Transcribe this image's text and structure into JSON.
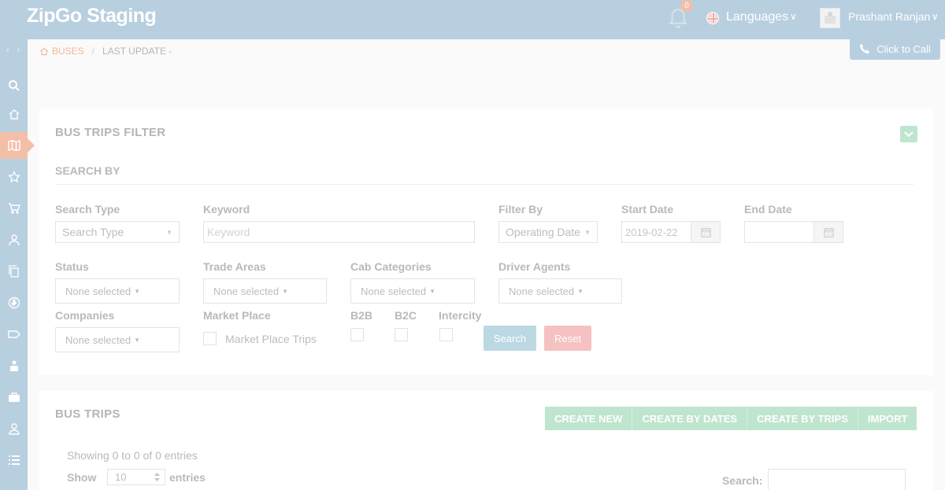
{
  "header": {
    "brand": "ZipGo Staging",
    "notification_count": "0",
    "languages_label": "Languages",
    "user_name": "Prashant Ranjan",
    "caret": "∨"
  },
  "sidebar": {
    "toggle": "‹ ›",
    "items": [
      {
        "icon": "search-icon"
      },
      {
        "icon": "home-icon"
      },
      {
        "icon": "map-icon",
        "active": true
      },
      {
        "icon": "star-icon"
      },
      {
        "icon": "cart-icon"
      },
      {
        "icon": "user-icon"
      },
      {
        "icon": "copy-icon"
      },
      {
        "icon": "globe-icon"
      },
      {
        "icon": "tag-icon"
      },
      {
        "icon": "badge-icon"
      },
      {
        "icon": "briefcase-icon"
      },
      {
        "icon": "person-icon"
      },
      {
        "icon": "list-icon"
      }
    ]
  },
  "breadcrumb": {
    "home": "BUSES",
    "separator": "/",
    "current": "LAST UPDATE -"
  },
  "call_button": "Click to Call",
  "filter": {
    "title": "BUS TRIPS FILTER",
    "subtitle": "SEARCH BY",
    "search_type_label": "Search Type",
    "search_type_value": "Search Type",
    "keyword_label": "Keyword",
    "keyword_placeholder": "Keyword",
    "filter_by_label": "Filter By",
    "filter_by_value": "Operating Date",
    "start_date_label": "Start Date",
    "start_date_value": "2019-02-22",
    "end_date_label": "End Date",
    "end_date_value": "",
    "status_label": "Status",
    "trade_areas_label": "Trade Areas",
    "cab_categories_label": "Cab Categories",
    "driver_agents_label": "Driver Agents",
    "companies_label": "Companies",
    "market_place_label": "Market Place",
    "market_place_option": "Market Place Trips",
    "b2b_label": "B2B",
    "b2c_label": "B2C",
    "intercity_label": "Intercity",
    "none_selected": "None selected",
    "search_button": "Search",
    "reset_button": "Reset"
  },
  "trips": {
    "title": "BUS TRIPS",
    "actions": [
      "CREATE NEW",
      "CREATE BY DATES",
      "CREATE BY TRIPS",
      "IMPORT"
    ],
    "info": "Showing 0 to 0 of 0 entries",
    "show_label": "Show",
    "page_size": "10",
    "entries_label": "entries",
    "search_label": "Search:"
  },
  "colors": {
    "header_bg": "#b8cfe0",
    "accent": "#f3bfa8",
    "green_btn": "#bfe5cf",
    "search_btn": "#bcd8e2",
    "reset_btn": "#f5c1c1"
  }
}
